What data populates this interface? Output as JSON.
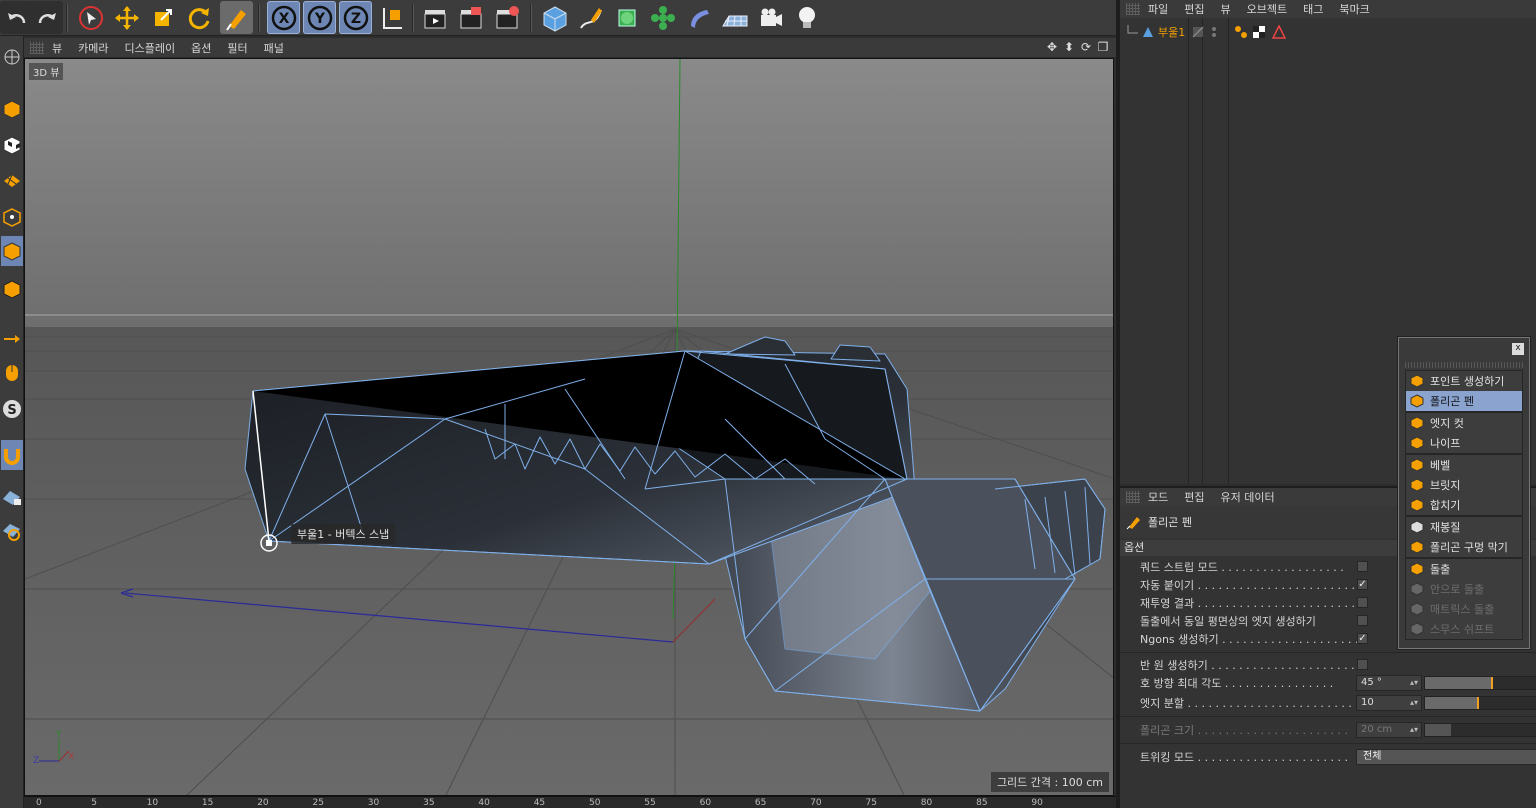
{
  "viewport": {
    "menu": [
      "뷰",
      "카메라",
      "디스플레이",
      "옵션",
      "필터",
      "패널"
    ],
    "label": "3D 뷰",
    "snap_tooltip": "부울1 - 버텍스 스냅",
    "grid_spacing": "그리드 간격 : 100 cm",
    "axis_labels": {
      "y": "Y",
      "z": "Z",
      "x": "X"
    }
  },
  "toolbar": {
    "axis_x": "X",
    "axis_y": "Y",
    "axis_z": "Z"
  },
  "timeline": {
    "ticks": [
      "0",
      "5",
      "10",
      "15",
      "20",
      "25",
      "30",
      "35",
      "40",
      "45",
      "50",
      "55",
      "60",
      "65",
      "70",
      "75",
      "80",
      "85",
      "90"
    ]
  },
  "object_manager": {
    "menu": [
      "파일",
      "편집",
      "뷰",
      "오브젝트",
      "태그",
      "북마크"
    ],
    "object_name": "부울1"
  },
  "attribute_manager": {
    "menu": [
      "모드",
      "편집",
      "유저 데이터"
    ],
    "tool_name": "폴리곤 펜",
    "section": "옵션",
    "options": [
      {
        "label": "쿼드 스트립 모드 . . . . . . . . . . . . . . . . . .",
        "checked": ""
      },
      {
        "label": "자동 붙이기 . . . . . . . . . . . . . . . . . . . . . . .",
        "checked": "✓"
      },
      {
        "label": "재투영 결과 . . . . . . . . . . . . . . . . . . . . . . .",
        "checked": ""
      },
      {
        "label": "돌출에서 동일 평면상의 엣지 생성하기",
        "checked": ""
      },
      {
        "label": "Ngons 생성하기 . . . . . . . . . . . . . . . . . . . .",
        "checked": "✓"
      }
    ],
    "semicircle": {
      "label": "반 원 생성하기 . . . . . . . . . . . . . . . . . . . . .",
      "checked": ""
    },
    "arc_max_angle": {
      "label": "호 방향 최대 각도 . . . . . . . . . . . . . . . .",
      "value": "45 °",
      "fraction": 0.5
    },
    "edge_subdivision": {
      "label": "엣지 분할 . . . . . . . . . . . . . . . . . . . . . . . .",
      "value": "10",
      "fraction": 0.4
    },
    "polygon_size": {
      "label": "폴리곤 크기 . . . . . . . . . . . . . . . . . . . . . .",
      "value": "20 cm",
      "fraction": 0.2
    },
    "tweak_mode": {
      "label": "트위킹 모드 . . . . . . . . . . . . . . . . . . . . . .",
      "value": "전체"
    }
  },
  "palette": {
    "close": "x",
    "groups": [
      [
        {
          "label": "포인트 생성하기",
          "icon": "point-icon",
          "state": ""
        },
        {
          "label": "폴리곤 펜",
          "icon": "polygon-pen-icon",
          "state": "sel"
        }
      ],
      [
        {
          "label": "엣지 컷",
          "icon": "edge-cut-icon",
          "state": ""
        },
        {
          "label": "나이프",
          "icon": "knife-icon",
          "state": ""
        }
      ],
      [
        {
          "label": "베벨",
          "icon": "bevel-icon",
          "state": ""
        },
        {
          "label": "브릿지",
          "icon": "bridge-icon",
          "state": ""
        },
        {
          "label": "합치기",
          "icon": "weld-icon",
          "state": ""
        }
      ],
      [
        {
          "label": "재봉질",
          "icon": "stitch-icon",
          "state": ""
        },
        {
          "label": "폴리곤 구멍 막기",
          "icon": "close-hole-icon",
          "state": ""
        }
      ],
      [
        {
          "label": "돌출",
          "icon": "extrude-icon",
          "state": ""
        },
        {
          "label": "안으로 돌출",
          "icon": "extrude-inner-icon",
          "state": "dis"
        },
        {
          "label": "매트릭스 돌출",
          "icon": "matrix-extrude-icon",
          "state": "dis"
        },
        {
          "label": "스무스 쉬프트",
          "icon": "smooth-shift-icon",
          "state": "dis"
        }
      ]
    ]
  },
  "colors": {
    "selection": "#6d86b3",
    "palette_selection": "#8aa3cf",
    "wire": "#7fb0ea",
    "slider_mark": "#f0a020"
  }
}
